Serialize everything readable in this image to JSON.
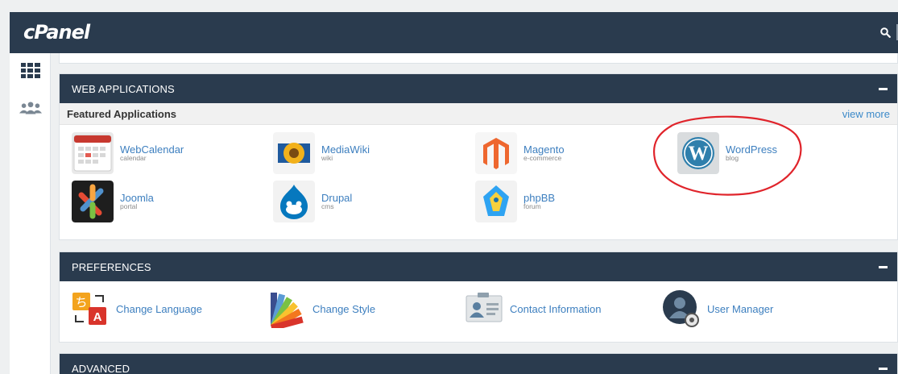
{
  "header": {
    "logo": "cPanel",
    "search_icon": "search-icon"
  },
  "sidebar": {
    "items": [
      {
        "icon": "grid-icon"
      },
      {
        "icon": "users-icon"
      }
    ]
  },
  "web_applications": {
    "title": "WEB APPLICATIONS",
    "featured_title": "Featured Applications",
    "view_more": "view more",
    "apps": [
      {
        "name": "WebCalendar",
        "category": "calendar",
        "icon": "webcalendar-icon"
      },
      {
        "name": "MediaWiki",
        "category": "wiki",
        "icon": "mediawiki-icon"
      },
      {
        "name": "Magento",
        "category": "e-commerce",
        "icon": "magento-icon"
      },
      {
        "name": "WordPress",
        "category": "blog",
        "icon": "wordpress-icon"
      },
      {
        "name": "Joomla",
        "category": "portal",
        "icon": "joomla-icon"
      },
      {
        "name": "Drupal",
        "category": "cms",
        "icon": "drupal-icon"
      },
      {
        "name": "phpBB",
        "category": "forum",
        "icon": "phpbb-icon"
      }
    ]
  },
  "preferences": {
    "title": "PREFERENCES",
    "items": [
      {
        "label": "Change Language",
        "icon": "language-icon"
      },
      {
        "label": "Change Style",
        "icon": "palette-icon"
      },
      {
        "label": "Contact Information",
        "icon": "contact-card-icon"
      },
      {
        "label": "User Manager",
        "icon": "user-manager-icon"
      }
    ]
  },
  "advanced": {
    "title": "ADVANCED"
  },
  "colors": {
    "header_bg": "#2a3b4e",
    "link": "#3d7fbf",
    "annotation": "#e0242b"
  }
}
